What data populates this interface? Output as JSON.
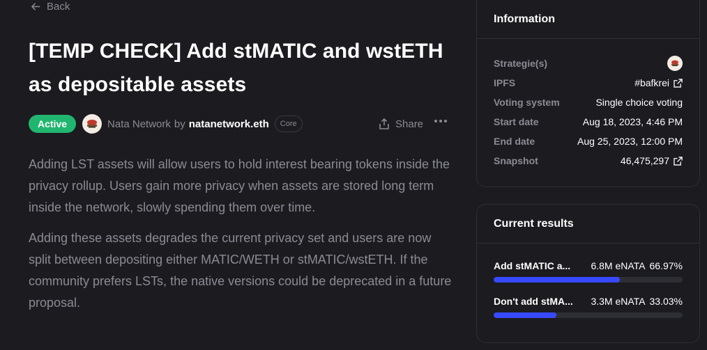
{
  "nav": {
    "back_label": "Back"
  },
  "proposal": {
    "title": "[TEMP CHECK] Add stMATIC and wstETH as depositable assets",
    "status": "Active",
    "space_name": "Nata Network",
    "by_label": "by",
    "author": "natanetwork.eth",
    "author_badge": "Core",
    "share_label": "Share",
    "paragraphs": [
      "Adding LST assets will allow users to hold interest bearing tokens inside the privacy rollup. Users gain more privacy when assets are stored long term inside the network, slowly spending them over time.",
      "Adding these assets degrades the current privacy set and users are now split between depositing either MATIC/WETH or stMATIC/wstETH. If the community prefers LSTs, the native versions could be deprecated in a future proposal."
    ]
  },
  "information": {
    "heading": "Information",
    "rows": [
      {
        "label": "Strategie(s)",
        "value": ""
      },
      {
        "label": "IPFS",
        "value": "#bafkrei"
      },
      {
        "label": "Voting system",
        "value": "Single choice voting"
      },
      {
        "label": "Start date",
        "value": "Aug 18, 2023, 4:46 PM"
      },
      {
        "label": "End date",
        "value": "Aug 25, 2023, 12:00 PM"
      },
      {
        "label": "Snapshot",
        "value": "46,475,297"
      }
    ]
  },
  "results": {
    "heading": "Current results",
    "items": [
      {
        "choice": "Add stMATIC a...",
        "votes": "6.8M eNATA",
        "percent": "66.97%",
        "fraction": 0.6697
      },
      {
        "choice": "Don't add stMA...",
        "votes": "3.3M eNATA",
        "percent": "33.03%",
        "fraction": 0.3303
      }
    ]
  },
  "colors": {
    "background": "#1c1b20",
    "active_badge": "#21b66f",
    "result_bar": "#384aff",
    "muted_text": "#8b8b94"
  },
  "icons": {
    "back": "arrow-left-icon",
    "share": "share-icon",
    "more": "more-horizontal-icon",
    "external": "external-link-icon",
    "avatar": "nata-network-logo"
  }
}
